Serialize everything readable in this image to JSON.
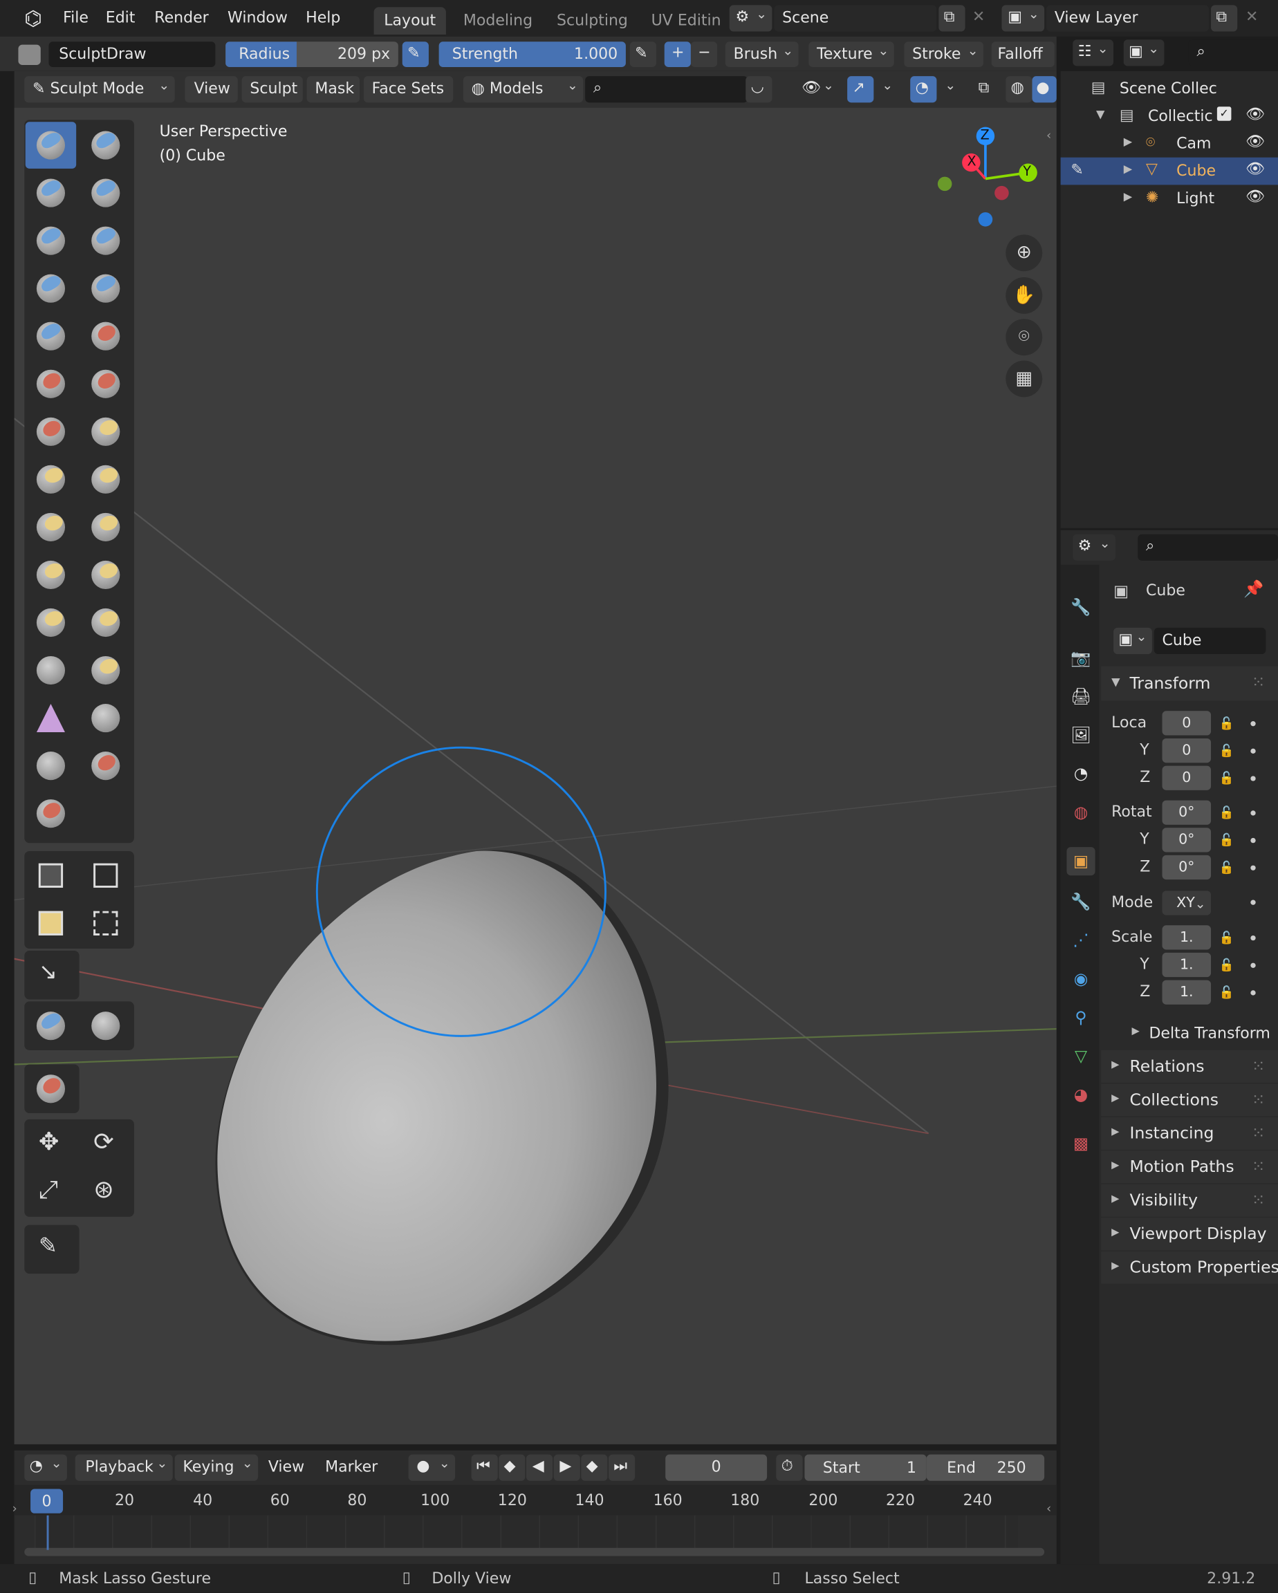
{
  "menu": {
    "items": [
      "File",
      "Edit",
      "Render",
      "Window",
      "Help"
    ],
    "workspaces": [
      "Layout",
      "Modeling",
      "Sculpting",
      "UV Editin"
    ],
    "active_workspace": "Layout",
    "scene": "Scene",
    "view_layer": "View Layer"
  },
  "tool_header": {
    "brush_name": "SculptDraw",
    "radius_label": "Radius",
    "radius_value": "209 px",
    "strength_label": "Strength",
    "strength_value": "1.000",
    "plus": "+",
    "minus": "−",
    "brush": "Brush",
    "texture": "Texture",
    "stroke": "Stroke",
    "falloff": "Falloff"
  },
  "viewport_header": {
    "mode": "Sculpt Mode",
    "view": "View",
    "sculpt": "Sculpt",
    "mask": "Mask",
    "face_sets": "Face Sets",
    "models": "Models"
  },
  "viewport": {
    "perspective": "User Perspective",
    "object": "(0) Cube",
    "axes": {
      "x": "X",
      "y": "Y",
      "z": "Z"
    },
    "colors": {
      "x": "#ff3352",
      "y": "#8bdc00",
      "z": "#2890ff",
      "brush_circle": "#1a82e6"
    }
  },
  "outliner": {
    "scene_collection": "Scene Collec",
    "collection": "Collectic",
    "items": [
      {
        "label": "Cam",
        "icon": "camera-icon",
        "color": "#e8a34a"
      },
      {
        "label": "Cube",
        "icon": "mesh-icon",
        "color": "#e8a34a"
      },
      {
        "label": "Light",
        "icon": "light-icon",
        "color": "#e8a34a"
      }
    ]
  },
  "properties": {
    "object_name": "Cube",
    "data_name": "Cube",
    "transform": "Transform",
    "location_label": "Loca",
    "rotation_label": "Rotat",
    "mode_label": "Mode",
    "mode_value": "XY",
    "scale_label": "Scale",
    "y": "Y",
    "z": "Z",
    "location": [
      "0",
      "0",
      "0"
    ],
    "rotation": [
      "0°",
      "0°",
      "0°"
    ],
    "scale": [
      "1.",
      "1.",
      "1."
    ],
    "delta": "Delta Transform",
    "panels": [
      "Relations",
      "Collections",
      "Instancing",
      "Motion Paths",
      "Visibility",
      "Viewport Display",
      "Custom Properties"
    ]
  },
  "timeline": {
    "playback": "Playback",
    "keying": "Keying",
    "view": "View",
    "marker": "Marker",
    "current_frame": "0",
    "start_label": "Start",
    "start_value": "1",
    "end_label": "End",
    "end_value": "250",
    "ticks": [
      "0",
      "20",
      "40",
      "60",
      "80",
      "100",
      "120",
      "140",
      "160",
      "180",
      "200",
      "220",
      "240"
    ]
  },
  "status": {
    "left": "Mask Lasso Gesture",
    "middle": "Dolly View",
    "right": "Lasso Select",
    "version": "2.91.2"
  }
}
